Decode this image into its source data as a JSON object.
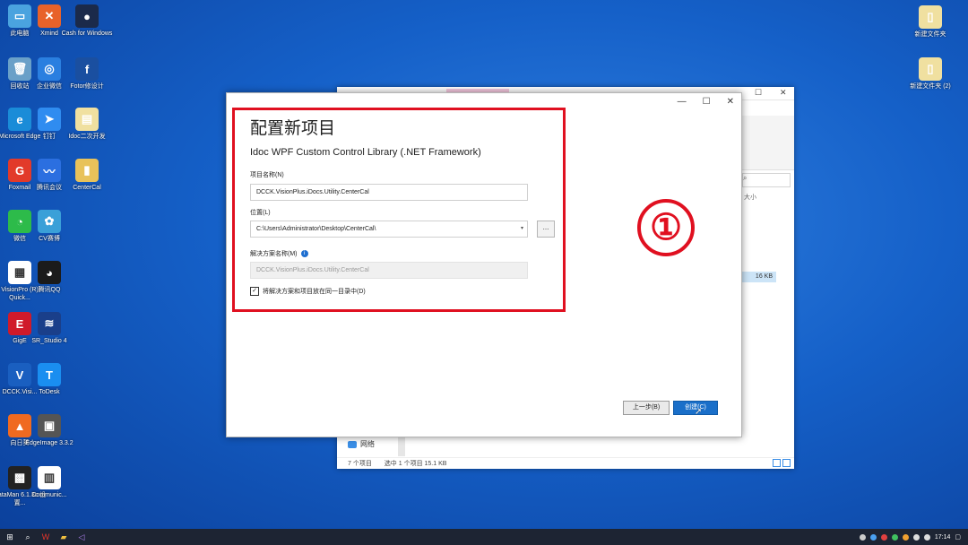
{
  "desktop_icons": [
    {
      "label": "此电脑",
      "glyph": "▭",
      "color": "#4aa3df"
    },
    {
      "label": "Xmind",
      "glyph": "✕",
      "color": "#e8622a"
    },
    {
      "label": "Cash for Windows",
      "glyph": "●",
      "color": "#1b2a4a"
    },
    {
      "label": "回收站",
      "glyph": "🗑",
      "color": "#6aa0c8"
    },
    {
      "label": "企业微信",
      "glyph": "◎",
      "color": "#2a7fe0"
    },
    {
      "label": "Fotor修设计",
      "glyph": "f",
      "color": "#1a4fa0"
    },
    {
      "label": "Microsoft Edge",
      "glyph": "e",
      "color": "#1a8cd8"
    },
    {
      "label": "钉钉",
      "glyph": "➤",
      "color": "#2f8cf0"
    },
    {
      "label": "Idoc二次开发",
      "glyph": "▤",
      "color": "#f0e0a0"
    },
    {
      "label": "Foxmail",
      "glyph": "G",
      "color": "#e23a2a"
    },
    {
      "label": "腾讯会议",
      "glyph": "〰",
      "color": "#2b6fe0"
    },
    {
      "label": "CenterCal",
      "glyph": "▮",
      "color": "#e8c25a"
    },
    {
      "label": "微信",
      "glyph": "◔",
      "color": "#2dbb4a"
    },
    {
      "label": "CV赛博",
      "glyph": "✿",
      "color": "#3aa0d8"
    },
    {
      "label": "VisionPro (R) Quick...",
      "glyph": "▦",
      "color": "#ffffff"
    },
    {
      "label": "腾讯QQ",
      "glyph": "◕",
      "color": "#1b1b1b"
    },
    {
      "label": "GigE",
      "glyph": "E",
      "color": "#d01a2a"
    },
    {
      "label": "SR_Studio 4",
      "glyph": "≋",
      "color": "#1a3f8a"
    },
    {
      "label": "DCCK.Visi...",
      "glyph": "V",
      "color": "#1a5fc0"
    },
    {
      "label": "ToDesk",
      "glyph": "T",
      "color": "#1a8ef0"
    },
    {
      "label": "向日葵",
      "glyph": "▲",
      "color": "#f06a20"
    },
    {
      "label": "EdgeImage 3.3.2",
      "glyph": "▣",
      "color": "#555555"
    },
    {
      "label": "DataMan 6.1.3c 设置...",
      "glyph": "▩",
      "color": "#222222"
    },
    {
      "label": "Communic...",
      "glyph": "▥",
      "color": "#ffffff"
    },
    {
      "label": "新建文件夹",
      "glyph": "▯",
      "color": "#f0e0a0"
    },
    {
      "label": "新建文件夹 (2)",
      "glyph": "▯",
      "color": "#f0e0a0"
    }
  ],
  "explorer": {
    "search_placeholder": "",
    "col_header": "大小",
    "size_value": "16 KB",
    "nav_network": "网络",
    "status_count": "7 个项目",
    "status_selected": "选中 1 个项目  15.1 KB"
  },
  "dialog": {
    "title": "配置新项目",
    "template_name": "Idoc WPF Custom Control Library (.NET Framework)",
    "project_name_label": "项目名称(N)",
    "project_name_value": "DCCK.VisionPlus.iDocs.Utility.CenterCal",
    "location_label": "位置(L)",
    "location_value": "C:\\Users\\Administrator\\Desktop\\CenterCal\\",
    "browse_label": "...",
    "solution_label": "解决方案名称(M)",
    "solution_value": "DCCK.VisionPlus.iDocs.Utility.CenterCal",
    "same_dir_label": "将解决方案和项目放在同一目录中(D)",
    "same_dir_checked": true,
    "back_button": "上一步(B)",
    "create_button": "创建(C)",
    "minimize": "—",
    "maximize": "☐",
    "close": "✕"
  },
  "annotation": {
    "marker": "①",
    "color": "#e01020"
  },
  "taskbar": {
    "clock": "17:14",
    "accent": "#1d2433"
  }
}
